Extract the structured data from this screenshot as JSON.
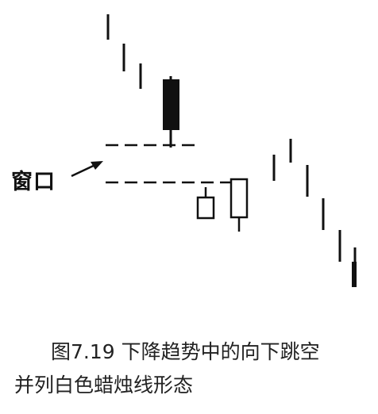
{
  "figure": {
    "annotation": "窗口",
    "caption_line_1": "图7.19 下降趋势中的向下跳空",
    "caption_line_2": "并列白色蜡烛线形态"
  }
}
